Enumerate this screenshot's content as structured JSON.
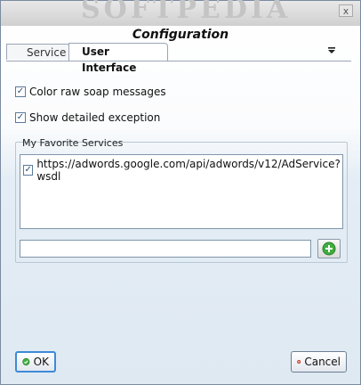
{
  "window": {
    "watermark": "SOFTPEDIA",
    "close_glyph": "x"
  },
  "dialog": {
    "title": "Configuration"
  },
  "tabs": [
    {
      "label": "Service",
      "active": false
    },
    {
      "label": "User Interface",
      "active": true
    }
  ],
  "tab_menu_icon": "overflow-menu-icon",
  "options": {
    "color_raw_soap": {
      "label": "Color raw soap messages",
      "checked": true
    },
    "show_detailed_exception": {
      "label": "Show detailed exception",
      "checked": true
    }
  },
  "favorites": {
    "group_label": "My Favorite Services",
    "items": [
      {
        "url": "https://adwords.google.com/api/adwords/v12/AdService?wsdl",
        "checked": true
      }
    ],
    "new_service_value": "",
    "add_icon": "plus-circle-icon"
  },
  "buttons": {
    "ok_label": "OK",
    "ok_icon": "check-circle-icon",
    "cancel_label": "Cancel",
    "cancel_icon": "x-circle-icon"
  },
  "colors": {
    "ok_icon": "#3fae3f",
    "cancel_icon": "#d23a2a",
    "add_icon": "#3fae3f",
    "focus_border": "#3d8ad8"
  }
}
